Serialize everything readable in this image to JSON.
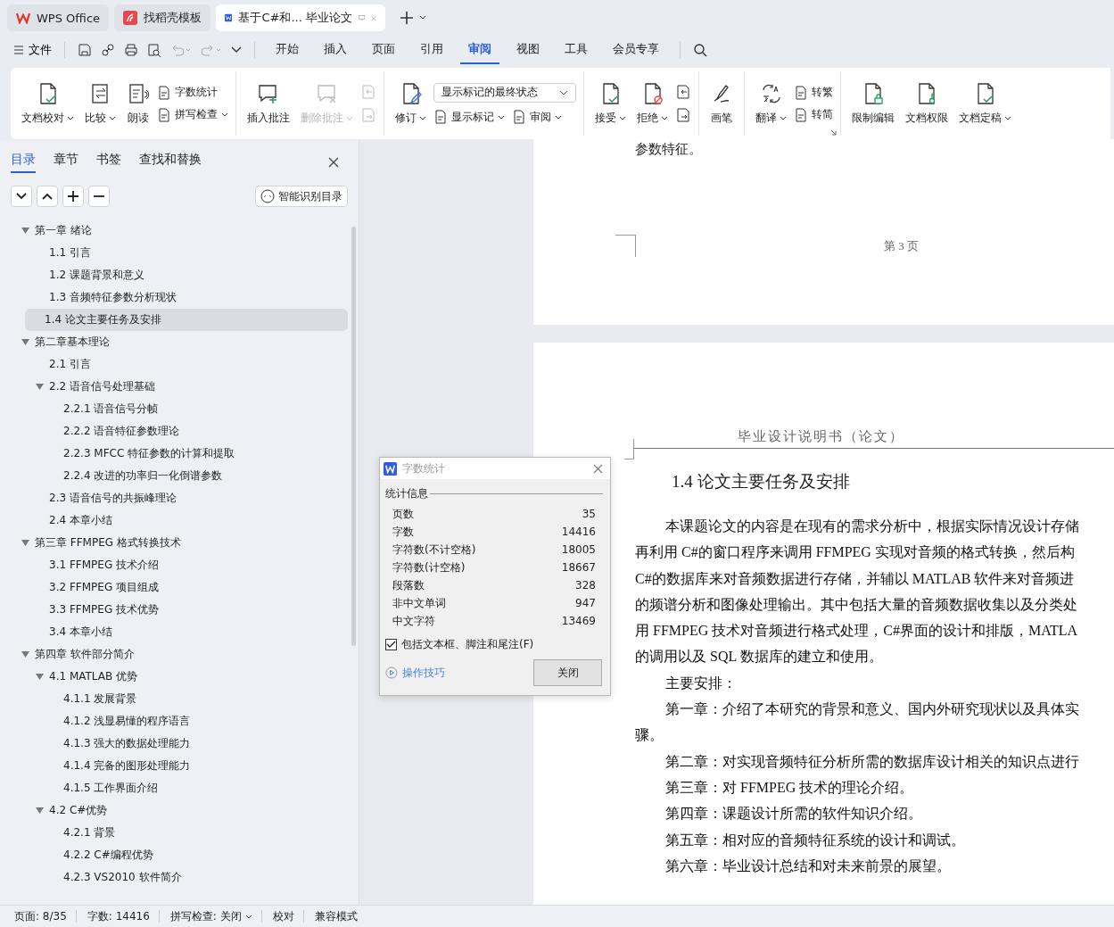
{
  "tabs": [
    {
      "label": "WPS Office",
      "kind": "home",
      "selected": false
    },
    {
      "label": "找稻壳模板",
      "kind": "template",
      "selected": false
    },
    {
      "label": "基于C#和... 毕业论文",
      "kind": "document",
      "selected": true
    }
  ],
  "menu": {
    "file": "文件",
    "tabs": [
      {
        "label": "开始",
        "selected": false
      },
      {
        "label": "插入",
        "selected": false
      },
      {
        "label": "页面",
        "selected": false
      },
      {
        "label": "引用",
        "selected": false
      },
      {
        "label": "审阅",
        "selected": true
      },
      {
        "label": "视图",
        "selected": false
      },
      {
        "label": "工具",
        "selected": false
      },
      {
        "label": "会员专享",
        "selected": false
      }
    ]
  },
  "ribbon": {
    "groups": [
      {
        "items": [
          {
            "kind": "large",
            "label": "文档校对",
            "dropdown": true,
            "disabled": false
          },
          {
            "kind": "large",
            "label": "比较",
            "dropdown": true,
            "disabled": false
          },
          {
            "kind": "large",
            "label": "朗读",
            "disabled": false
          },
          {
            "kind": "stack",
            "items": [
              {
                "label": "字数统计"
              },
              {
                "label": "拼写检查",
                "dropdown": true
              }
            ]
          }
        ]
      },
      {
        "items": [
          {
            "kind": "large",
            "label": "插入批注",
            "disabled": false
          },
          {
            "kind": "large",
            "label": "删除批注",
            "dropdown": true,
            "disabled": true
          },
          {
            "kind": "icon-stack",
            "disabled": true
          }
        ]
      },
      {
        "items": [
          {
            "kind": "large",
            "label": "修订",
            "dropdown": true,
            "disabled": false
          },
          {
            "kind": "select-stack",
            "value": "显示标记的最终状态",
            "items": [
              {
                "label": "显示标记",
                "dropdown": true
              },
              {
                "label": "审阅",
                "dropdown": true
              }
            ]
          }
        ]
      },
      {
        "items": [
          {
            "kind": "large",
            "label": "接受",
            "dropdown": true,
            "disabled": false
          },
          {
            "kind": "large",
            "label": "拒绝",
            "dropdown": true,
            "disabled": false
          },
          {
            "kind": "icon-stack",
            "disabled": false
          }
        ]
      },
      {
        "items": [
          {
            "kind": "large",
            "label": "画笔",
            "disabled": false
          }
        ]
      },
      {
        "launcher": true,
        "items": [
          {
            "kind": "large",
            "label": "翻译",
            "dropdown": true,
            "disabled": false
          },
          {
            "kind": "stack",
            "items": [
              {
                "label": "转繁"
              },
              {
                "label": "转简"
              }
            ]
          }
        ]
      },
      {
        "items": [
          {
            "kind": "large",
            "label": "限制编辑",
            "disabled": false
          },
          {
            "kind": "large",
            "label": "文档权限",
            "disabled": false
          },
          {
            "kind": "large",
            "label": "文档定稿",
            "dropdown": true,
            "disabled": false
          }
        ]
      }
    ]
  },
  "nav": {
    "tabs": [
      {
        "label": "目录",
        "selected": true
      },
      {
        "label": "章节",
        "selected": false
      },
      {
        "label": "书签",
        "selected": false
      },
      {
        "label": "查找和替换",
        "selected": false
      }
    ],
    "smart_button": "智能识别目录",
    "tree": [
      {
        "label": "第一章  绪论",
        "selected": false,
        "expanded": true,
        "children": [
          {
            "label": "1.1  引言",
            "selected": false
          },
          {
            "label": "1.2 课题背景和意义",
            "selected": false
          },
          {
            "label": "1.3  音频特征参数分析现状",
            "selected": false
          },
          {
            "label": "1.4 论文主要任务及安排",
            "selected": true
          }
        ]
      },
      {
        "label": "第二章基本理论",
        "selected": false,
        "expanded": true,
        "children": [
          {
            "label": "2.1  引言",
            "selected": false
          },
          {
            "label": "2.2  语音信号处理基础",
            "selected": false,
            "expanded": true,
            "children": [
              {
                "label": "2.2.1 语音信号分帧",
                "selected": false
              },
              {
                "label": "2.2.2 语音特征参数理论",
                "selected": false
              },
              {
                "label": "2.2.3 MFCC 特征参数的计算和提取",
                "selected": false
              },
              {
                "label": "2.2.4 改进的功率归一化倒谱参数",
                "selected": false
              }
            ]
          },
          {
            "label": "2.3 语音信号的共振峰理论",
            "selected": false
          },
          {
            "label": "2.4 本章小结",
            "selected": false
          }
        ]
      },
      {
        "label": "第三章  FFMPEG 格式转换技术",
        "selected": false,
        "expanded": true,
        "children": [
          {
            "label": "3.1 FFMPEG 技术介绍",
            "selected": false
          },
          {
            "label": "3.2 FFMPEG 项目组成",
            "selected": false
          },
          {
            "label": "3.3 FFMPEG 技术优势",
            "selected": false
          },
          {
            "label": "3.4 本章小结",
            "selected": false
          }
        ]
      },
      {
        "label": "第四章  软件部分简介",
        "selected": false,
        "expanded": true,
        "children": [
          {
            "label": "4.1 MATLAB 优势",
            "selected": false,
            "expanded": true,
            "children": [
              {
                "label": "4.1.1 发展背景",
                "selected": false
              },
              {
                "label": "4.1.2  浅显易懂的程序语言",
                "selected": false
              },
              {
                "label": "4.1.3  强大的数据处理能力",
                "selected": false
              },
              {
                "label": "4.1.4  完备的图形处理能力",
                "selected": false
              },
              {
                "label": "4.1.5  工作界面介绍",
                "selected": false
              }
            ]
          },
          {
            "label": "4.2 C#优势",
            "selected": false,
            "expanded": true,
            "children": [
              {
                "label": "4.2.1 背景",
                "selected": false
              },
              {
                "label": "4.2.2 C#编程优势",
                "selected": false
              },
              {
                "label": "4.2.3 VS2010 软件简介",
                "selected": false
              }
            ]
          }
        ]
      }
    ]
  },
  "document": {
    "pages": [
      {
        "kind": "tail",
        "lines": [
          "参数特征。"
        ],
        "footer": "第  3  页"
      },
      {
        "kind": "body",
        "header": "毕业设计说明书（论文）",
        "heading": "1.4 论文主要任务及安排",
        "paragraphs": [
          {
            "text": "本课题论文的内容是在现有的需求分析中，根据实际情况设计存储",
            "indent": true
          },
          {
            "text": "再利用 C#的窗口程序来调用 FFMPEG 实现对音频的格式转换，然后构",
            "indent": false
          },
          {
            "text": "C#的数据库来对音频数据进行存储，并辅以 MATLAB 软件来对音频进",
            "indent": false
          },
          {
            "text": "的频谱分析和图像处理输出。其中包括大量的音频数据收集以及分类处",
            "indent": false
          },
          {
            "text": "用 FFMPEG 技术对音频进行格式处理，C#界面的设计和排版，MATLA",
            "indent": false
          },
          {
            "text": "的调用以及 SQL 数据库的建立和使用。",
            "indent": false
          },
          {
            "text": "主要安排：",
            "indent": true
          },
          {
            "text": "第一章：介绍了本研究的背景和意义、国内外研究现状以及具体实",
            "indent": true
          },
          {
            "text": "骤。",
            "indent": false
          },
          {
            "text": "第二章：对实现音频特征分析所需的数据库设计相关的知识点进行",
            "indent": true
          },
          {
            "text": "第三章：对 FFMPEG 技术的理论介绍。",
            "indent": true
          },
          {
            "text": "第四章：课题设计所需的软件知识介绍。",
            "indent": true
          },
          {
            "text": "第五章：相对应的音频特征系统的设计和调试。",
            "indent": true
          },
          {
            "text": "第六章：毕业设计总结和对未来前景的展望。",
            "indent": true
          }
        ]
      }
    ]
  },
  "dialog": {
    "title": "字数统计",
    "section": "统计信息",
    "stats": [
      {
        "label": "页数",
        "value": "35"
      },
      {
        "label": "字数",
        "value": "14416"
      },
      {
        "label": "字符数(不计空格)",
        "value": "18005"
      },
      {
        "label": "字符数(计空格)",
        "value": "18667"
      },
      {
        "label": "段落数",
        "value": "328"
      },
      {
        "label": "非中文单词",
        "value": "947"
      },
      {
        "label": "中文字符",
        "value": "13469"
      }
    ],
    "include_checkbox": {
      "label": "包括文本框、脚注和尾注(F)",
      "checked": true
    },
    "tips_link": "操作技巧",
    "close_button": "关闭"
  },
  "status_bar": {
    "items": [
      {
        "label": "页面: 8/35",
        "dropdown": false
      },
      {
        "label": "字数: 14416",
        "dropdown": false
      },
      {
        "label": "拼写检查: 关闭",
        "dropdown": true
      },
      {
        "label": "校对",
        "dropdown": false
      },
      {
        "label": "兼容模式",
        "dropdown": false
      }
    ]
  }
}
